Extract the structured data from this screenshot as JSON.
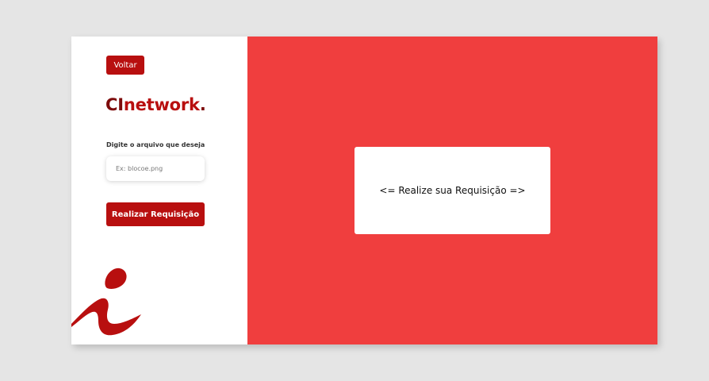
{
  "sidebar": {
    "back_label": "Voltar",
    "logo": {
      "part1": "CI",
      "part2": "network",
      "part3": "."
    },
    "field_label": "Digite o arquivo que deseja",
    "input": {
      "placeholder": "Ex: blocoe.png",
      "value": ""
    },
    "submit_label": "Realizar Requisição"
  },
  "main": {
    "result_text": "<= Realize sua Requisição =>"
  },
  "colors": {
    "accent_dark": "#7d0b0b",
    "accent": "#b80f0f",
    "panel_red": "#f03e3e",
    "background": "#e5e5e5"
  },
  "icons": {
    "brand_mark": "brand-i-icon"
  }
}
